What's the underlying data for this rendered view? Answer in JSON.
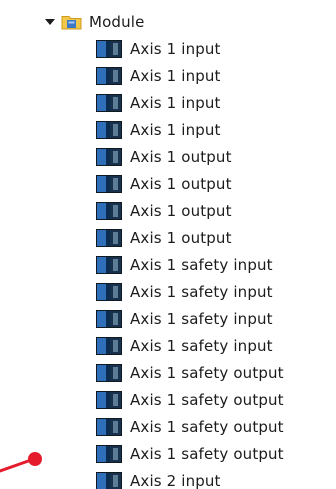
{
  "tree": {
    "folder": {
      "label": "Module",
      "icon": "folder-icon",
      "expander_icon": "expanded-triangle-icon",
      "expanded": true
    },
    "items": [
      {
        "label": "Axis 1 input",
        "icon": "module-icon"
      },
      {
        "label": "Axis 1 input",
        "icon": "module-icon"
      },
      {
        "label": "Axis 1 input",
        "icon": "module-icon"
      },
      {
        "label": "Axis 1 input",
        "icon": "module-icon"
      },
      {
        "label": "Axis 1 output",
        "icon": "module-icon"
      },
      {
        "label": "Axis 1 output",
        "icon": "module-icon"
      },
      {
        "label": "Axis 1 output",
        "icon": "module-icon"
      },
      {
        "label": "Axis 1 output",
        "icon": "module-icon"
      },
      {
        "label": "Axis 1 safety input",
        "icon": "module-icon"
      },
      {
        "label": "Axis 1 safety input",
        "icon": "module-icon"
      },
      {
        "label": "Axis 1 safety input",
        "icon": "module-icon"
      },
      {
        "label": "Axis 1 safety input",
        "icon": "module-icon"
      },
      {
        "label": "Axis 1 safety output",
        "icon": "module-icon"
      },
      {
        "label": "Axis 1 safety output",
        "icon": "module-icon"
      },
      {
        "label": "Axis 1 safety output",
        "icon": "module-icon"
      },
      {
        "label": "Axis 1 safety output",
        "icon": "module-icon"
      },
      {
        "label": "Axis 2 input",
        "icon": "module-icon"
      }
    ]
  },
  "colors": {
    "text": "#1c1c1c",
    "folder": "#f2c849",
    "folder_tab": "#3d77c7",
    "module_light": "#2f6fb9",
    "module_dark": "#101820",
    "annotation": "#e51c2c"
  }
}
